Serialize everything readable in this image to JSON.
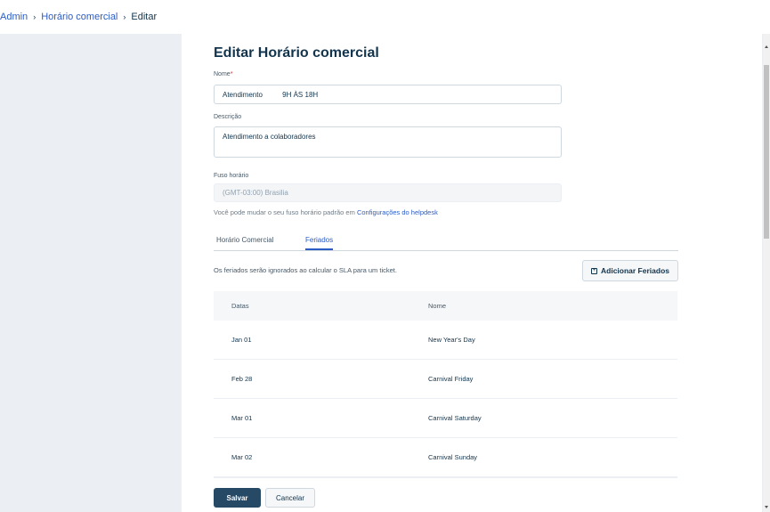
{
  "breadcrumb": {
    "root": "Admin",
    "parent": "Horário comercial",
    "current": "Editar",
    "separator": "›"
  },
  "form": {
    "title": "Editar Horário comercial",
    "name_label": "Nome",
    "required_mark": "*",
    "name_value": "Atendimento          9H ÀS 18H",
    "description_label": "Descrição",
    "description_value": "Atendimento a colaboradores",
    "timezone_label": "Fuso horário",
    "timezone_value": "(GMT-03:00) Brasilia",
    "timezone_hint": "Você pode mudar o seu fuso horário padrão em ",
    "timezone_hint_link": "Configurações do helpdesk"
  },
  "tabs": [
    {
      "label": "Horário Comercial",
      "active": false
    },
    {
      "label": "Feriados",
      "active": true
    }
  ],
  "holidays": {
    "note": "Os feriados serão ignorados ao calcular o SLA para um ticket.",
    "add_button_label": "Adicionar Feriados",
    "add_icon": "plus-square-icon",
    "columns": [
      "Datas",
      "Nome"
    ],
    "rows": [
      {
        "date": "Jan 01",
        "name": "New Year's Day"
      },
      {
        "date": "Feb 28",
        "name": "Carnival Friday"
      },
      {
        "date": "Mar 01",
        "name": "Carnival Saturday"
      },
      {
        "date": "Mar 02",
        "name": "Carnival Sunday"
      }
    ]
  },
  "actions": {
    "save_label": "Salvar",
    "cancel_label": "Cancelar"
  },
  "colors": {
    "primary_button": "#264966",
    "link": "#2c5cc5",
    "required": "#d72d30",
    "background": "#ebeff3"
  }
}
